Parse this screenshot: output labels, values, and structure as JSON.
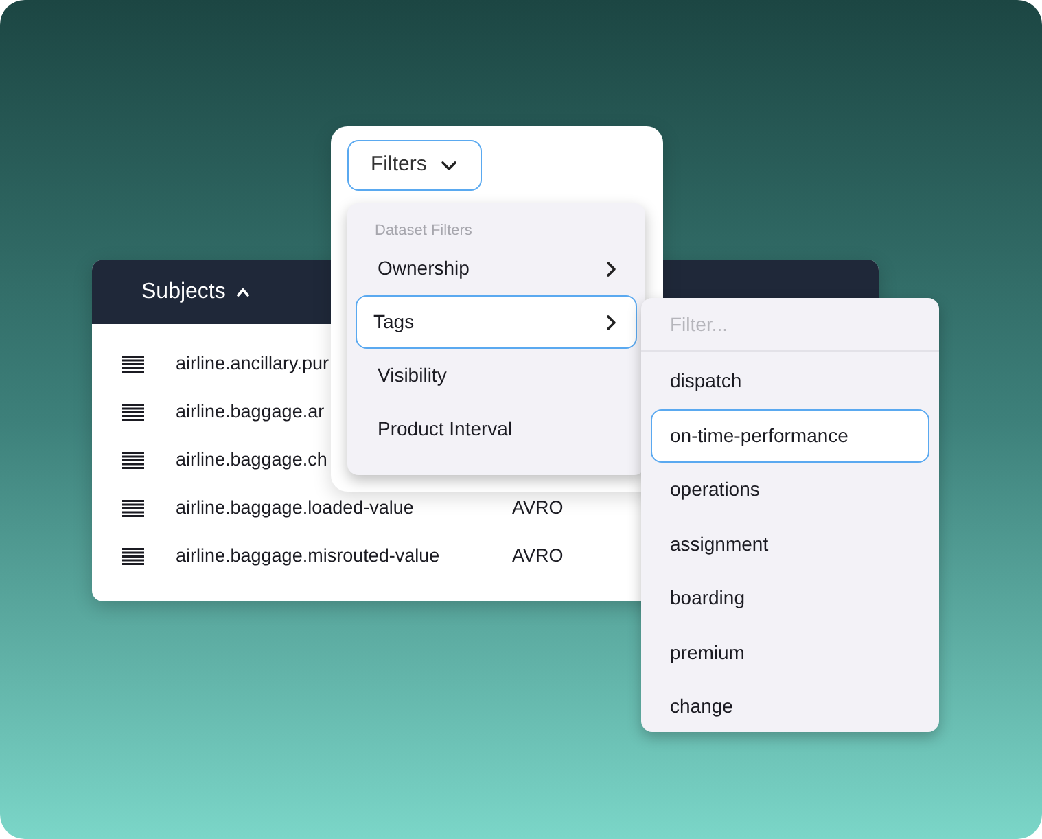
{
  "subjects_table": {
    "header": "Subjects",
    "rows": [
      {
        "name": "airline.ancillary.pur"
      },
      {
        "name": "airline.baggage.ar"
      },
      {
        "name": "airline.baggage.ch"
      },
      {
        "name": "airline.baggage.loaded-value",
        "format": "AVRO"
      },
      {
        "name": "airline.baggage.misrouted-value",
        "format": "AVRO"
      }
    ]
  },
  "filters": {
    "button": "Filters",
    "menu": {
      "heading": "Dataset Filters",
      "items": [
        {
          "label": "Ownership",
          "submenu": true,
          "selected": false
        },
        {
          "label": "Tags",
          "submenu": true,
          "selected": true
        },
        {
          "label": "Visibility",
          "submenu": false,
          "selected": false
        },
        {
          "label": "Product Interval",
          "submenu": false,
          "selected": false
        }
      ]
    }
  },
  "tag_menu": {
    "placeholder": "Filter...",
    "items": [
      {
        "label": "dispatch",
        "selected": false
      },
      {
        "label": "on-time-performance",
        "selected": true
      },
      {
        "label": "operations",
        "selected": false
      },
      {
        "label": "assignment",
        "selected": false
      },
      {
        "label": "boarding",
        "selected": false
      },
      {
        "label": "premium",
        "selected": false
      },
      {
        "label": "change",
        "selected": false
      }
    ]
  }
}
